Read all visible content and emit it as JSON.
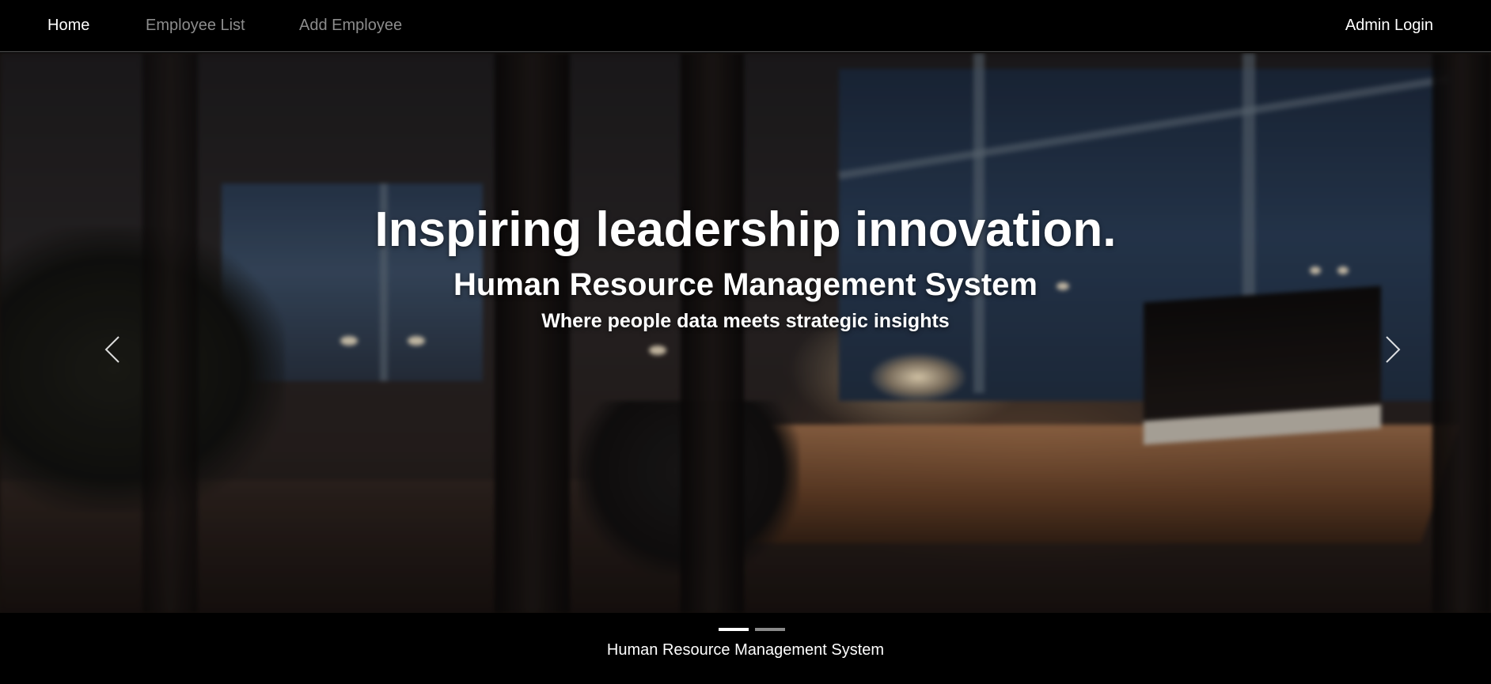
{
  "nav": {
    "items": [
      {
        "label": "Home",
        "active": true
      },
      {
        "label": "Employee List",
        "active": false
      },
      {
        "label": "Add Employee",
        "active": false
      }
    ],
    "admin_login": "Admin Login"
  },
  "hero": {
    "title": "Inspiring leadership innovation.",
    "subtitle": "Human Resource Management System",
    "tagline": "Where people data meets strategic insights",
    "prev_icon": "chevron-left-icon",
    "next_icon": "chevron-right-icon"
  },
  "carousel": {
    "slide_count": 2,
    "active_slide": 1,
    "caption": "Human Resource Management System"
  },
  "colors": {
    "background": "#000000",
    "nav_active": "#ffffff",
    "nav_inactive": "#8c8c8c",
    "indicator_inactive": "#8a8a8a"
  }
}
